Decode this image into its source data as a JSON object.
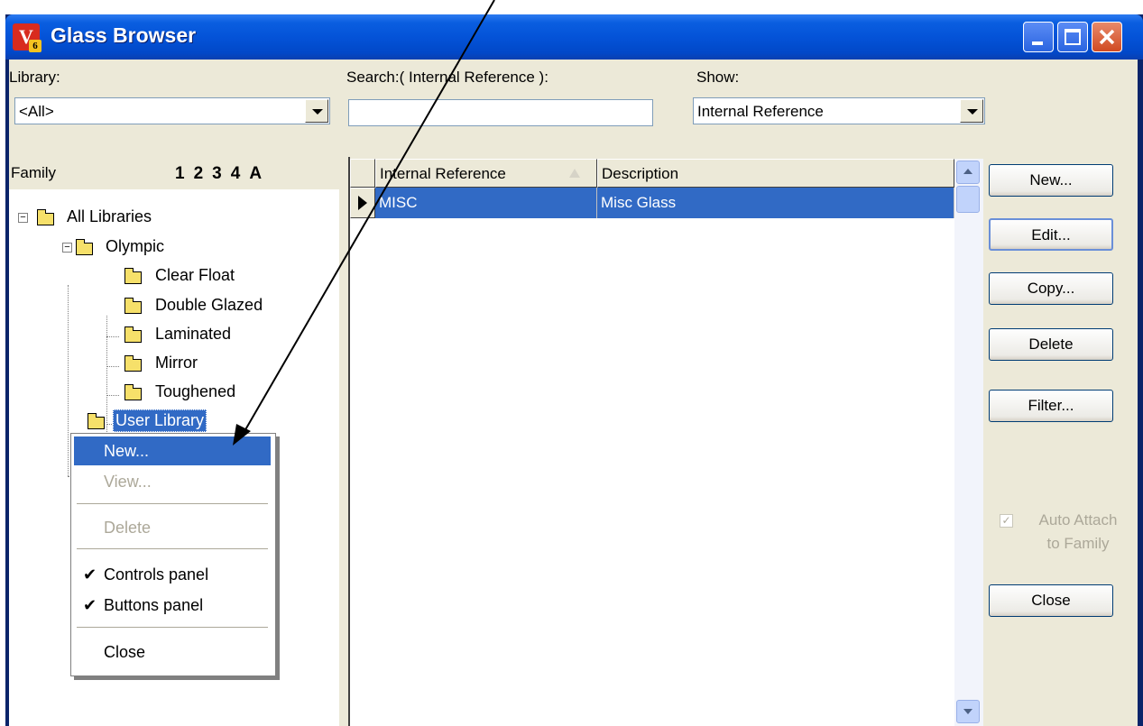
{
  "window": {
    "title": "Glass Browser",
    "icon_text": "V",
    "icon_badge": "6"
  },
  "titlebar_buttons": [
    "minimize-button",
    "maximize-button",
    "close-button"
  ],
  "filters": {
    "library_label": "Library:",
    "library_value": "<All>",
    "search_label": "Search:( Internal Reference ):",
    "search_value": "",
    "show_label": "Show:",
    "show_value": "Internal Reference"
  },
  "family_panel": {
    "header": "Family",
    "levels": [
      "1",
      "2",
      "3",
      "4",
      "A"
    ],
    "tree": [
      {
        "label": "All Libraries",
        "depth": 0
      },
      {
        "label": "Olympic",
        "depth": 1
      },
      {
        "label": "Clear Float",
        "depth": 2
      },
      {
        "label": "Double Glazed",
        "depth": 2
      },
      {
        "label": "Laminated",
        "depth": 2
      },
      {
        "label": "Mirror",
        "depth": 2
      },
      {
        "label": "Toughened",
        "depth": 2
      },
      {
        "label": "User Library",
        "depth": 1,
        "selected": true
      }
    ]
  },
  "grid": {
    "columns": [
      "Internal Reference",
      "Description"
    ],
    "rows": [
      {
        "internal_reference": "MISC",
        "description": "Misc Glass",
        "selected": true
      }
    ]
  },
  "buttons": {
    "new": "New...",
    "edit": "Edit...",
    "copy": "Copy...",
    "delete": "Delete",
    "filter": "Filter...",
    "close": "Close"
  },
  "auto_attach": {
    "line1": "Auto Attach",
    "line2": "to Family",
    "checked": true,
    "enabled": false
  },
  "context_menu": {
    "items": [
      {
        "label": "New...",
        "state": "highlighted"
      },
      {
        "label": "View...",
        "state": "disabled"
      },
      {
        "label": "Delete",
        "state": "disabled"
      },
      {
        "label": "Controls panel",
        "checked": true
      },
      {
        "label": "Buttons panel",
        "checked": true
      },
      {
        "label": "Close"
      }
    ]
  },
  "colors": {
    "selection": "#316ac5",
    "titlebar": "#0453d8",
    "face": "#ece9d8"
  }
}
